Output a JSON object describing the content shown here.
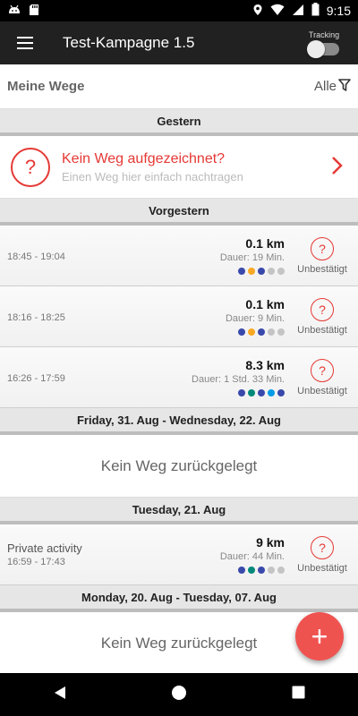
{
  "status_bar": {
    "time": "9:15",
    "left_icons": [
      "android-notification-icon",
      "sd-card-icon"
    ],
    "right_icons": [
      "location-icon",
      "wifi-icon",
      "signal-icon",
      "battery-icon"
    ]
  },
  "app_bar": {
    "title": "Test-Kampagne 1.5",
    "tracking_label": "Tracking",
    "tracking_enabled": false
  },
  "ways_header": {
    "title": "Meine Wege",
    "filter_label": "Alle"
  },
  "sections": {
    "yesterday": {
      "header": "Gestern",
      "empty_card": {
        "title": "Kein Weg aufgezeichnet?",
        "subtitle": "Einen Weg hier einfach nachtragen"
      }
    },
    "day_before": {
      "header": "Vorgestern",
      "trips": [
        {
          "time": "18:45 - 19:04",
          "distance": "0.1 km",
          "duration": "Dauer: 19 Min.",
          "status": "Unbestätigt",
          "dots": [
            "#3949ab",
            "#f9a825",
            "#3949ab",
            "#c4c4c4",
            "#c4c4c4"
          ]
        },
        {
          "time": "18:16 - 18:25",
          "distance": "0.1 km",
          "duration": "Dauer: 9 Min.",
          "status": "Unbestätigt",
          "dots": [
            "#3949ab",
            "#f9a825",
            "#3949ab",
            "#c4c4c4",
            "#c4c4c4"
          ]
        },
        {
          "time": "16:26 - 17:59",
          "distance": "8.3 km",
          "duration": "Dauer: 1 Std. 33 Min.",
          "status": "Unbestätigt",
          "dots": [
            "#3949ab",
            "#00897b",
            "#3949ab",
            "#039be5",
            "#3949ab"
          ]
        }
      ]
    },
    "range1": {
      "header": "Friday, 31. Aug - Wednesday, 22. Aug",
      "no_trip": "Kein Weg zurückgelegt"
    },
    "tuesday": {
      "header": "Tuesday, 21. Aug",
      "trip": {
        "name": "Private activity",
        "time": "16:59 - 17:43",
        "distance": "9 km",
        "duration": "Dauer: 44 Min.",
        "status": "Unbestätigt",
        "dots": [
          "#3949ab",
          "#00897b",
          "#3949ab",
          "#c4c4c4",
          "#c4c4c4"
        ]
      }
    },
    "range2": {
      "header": "Monday, 20. Aug - Tuesday, 07. Aug",
      "no_trip": "Kein Weg zurückgelegt"
    }
  },
  "fab": {
    "icon": "plus-icon",
    "glyph": "+"
  },
  "colors": {
    "accent": "#e53935",
    "fab": "#ef5350",
    "appbar": "#212121"
  }
}
